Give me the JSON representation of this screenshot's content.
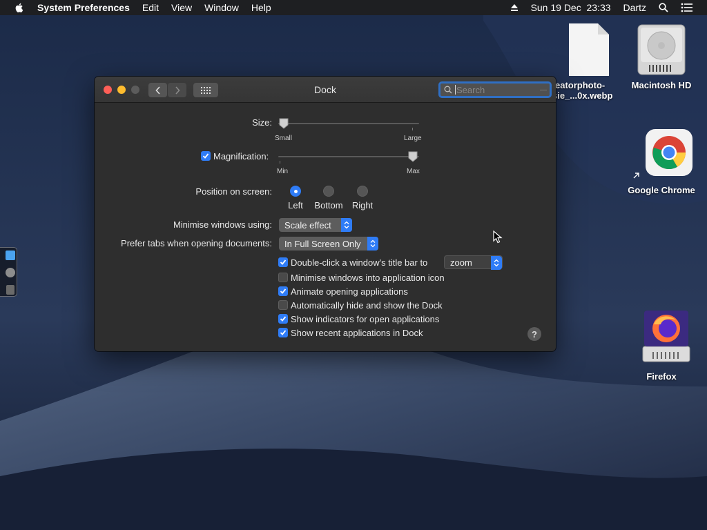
{
  "menubar": {
    "app_name": "System Preferences",
    "items": [
      "Edit",
      "View",
      "Window",
      "Help"
    ],
    "datetime": "Sun 19 Dec  23:33",
    "user": "Dartz"
  },
  "desktop": {
    "file_label_line1": "eatorphoto-",
    "file_label_line2": "sie_...0x.webp",
    "disk_label": "Macintosh HD",
    "chrome_label": "Google Chrome",
    "firefox_label": "Firefox"
  },
  "window": {
    "title": "Dock",
    "search_placeholder": "Search",
    "size": {
      "label": "Size:",
      "min_label": "Small",
      "max_label": "Large",
      "value": 0.0
    },
    "magnification": {
      "label": "Magnification:",
      "checked": true,
      "min_label": "Min",
      "max_label": "Max",
      "value": 1.0
    },
    "position": {
      "label": "Position on screen:",
      "options": [
        "Left",
        "Bottom",
        "Right"
      ],
      "selected": "Left"
    },
    "minimise": {
      "label": "Minimise windows using:",
      "value": "Scale effect"
    },
    "prefer_tabs": {
      "label": "Prefer tabs when opening documents:",
      "value": "In Full Screen Only"
    },
    "double_click": {
      "label": "Double-click a window's title bar to",
      "checked": true,
      "value": "zoom"
    },
    "checkboxes": [
      {
        "label": "Minimise windows into application icon",
        "checked": false
      },
      {
        "label": "Animate opening applications",
        "checked": true
      },
      {
        "label": "Automatically hide and show the Dock",
        "checked": false
      },
      {
        "label": "Show indicators for open applications",
        "checked": true
      },
      {
        "label": "Show recent applications in Dock",
        "checked": true
      }
    ],
    "help_label": "?"
  },
  "colors": {
    "accent": "#2f7cf6",
    "window_bg": "#2e2e2e",
    "close": "#ff5f57",
    "minimize": "#febc2e"
  }
}
